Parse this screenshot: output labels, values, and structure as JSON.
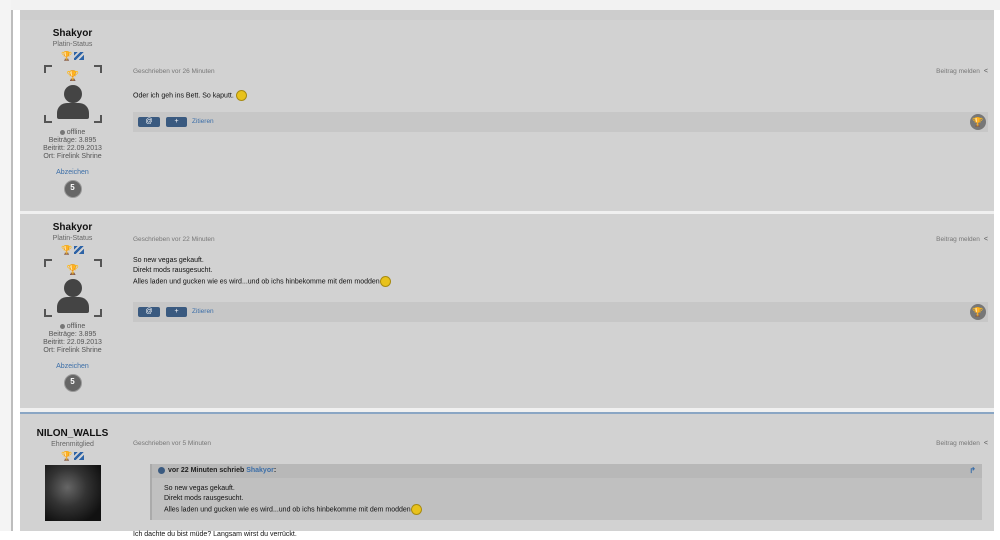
{
  "posts": [
    {
      "author": "Shakyor",
      "rank": "Platin-Status",
      "status": "offline",
      "beitraege": "Beiträge: 3.895",
      "beitritt": "Beitritt: 22.09.2013",
      "ort": "Ort: Firelink Shrine",
      "abzeichen": "Abzeichen",
      "level": "5",
      "time": "Geschrieben vor 26 Minuten",
      "report": "Beitrag melden",
      "lines": [
        "Oder ich geh ins Bett. So kaputt."
      ],
      "quote_label": "Zitieren"
    },
    {
      "author": "Shakyor",
      "rank": "Platin-Status",
      "status": "offline",
      "beitraege": "Beiträge: 3.895",
      "beitritt": "Beitritt: 22.09.2013",
      "ort": "Ort: Firelink Shrine",
      "abzeichen": "Abzeichen",
      "level": "5",
      "time": "Geschrieben vor 22 Minuten",
      "report": "Beitrag melden",
      "lines": [
        "So new vegas gekauft.",
        "Direkt mods rausgesucht.",
        "Alles laden und gucken wie es wird...und ob ichs hinbekomme mit dem modden"
      ],
      "quote_label": "Zitieren"
    },
    {
      "author": "NILON_WALLS",
      "rank": "Ehrenmitglied",
      "time": "Geschrieben vor 5 Minuten",
      "report": "Beitrag melden",
      "quote_head_prefix": "vor 22 Minuten schrieb",
      "quote_head_author": "Shakyor",
      "quote_lines": [
        "So new vegas gekauft.",
        "Direkt mods rausgesucht.",
        "Alles laden und gucken wie es wird...und ob ichs hinbekomme mit dem modden"
      ],
      "lines": [
        "Ich dachte du bist müde? Langsam wirst du verrückt."
      ]
    }
  ],
  "colors": {
    "accent": "#3a5a80",
    "link": "#3b6ea8",
    "bg": "#d2d2d2"
  }
}
